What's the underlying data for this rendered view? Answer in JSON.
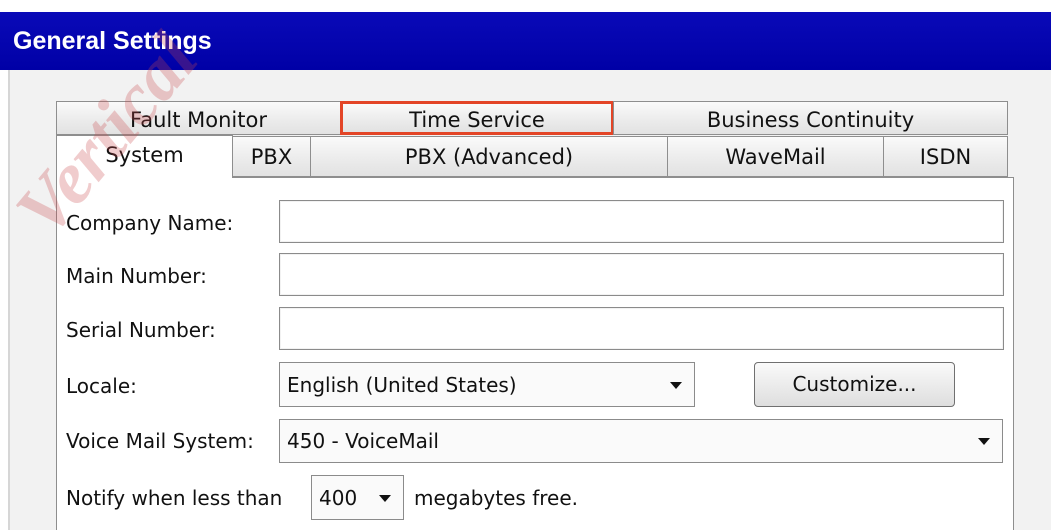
{
  "window": {
    "title": "General Settings",
    "watermark": "Vertical"
  },
  "tabs": {
    "row1": [
      "Fault Monitor",
      "Time Service",
      "Business Continuity"
    ],
    "row2": [
      "System",
      "PBX",
      "PBX (Advanced)",
      "WaveMail",
      "ISDN"
    ],
    "selected": "System",
    "highlighted": "Time Service"
  },
  "system": {
    "company_name_label": "Company Name:",
    "company_name_value": "",
    "main_number_label": "Main Number:",
    "main_number_value": "",
    "serial_number_label": "Serial Number:",
    "serial_number_value": "",
    "locale_label": "Locale:",
    "locale_value": "English (United States)",
    "customize_label": "Customize...",
    "voice_mail_label": "Voice Mail System:",
    "voice_mail_value": "450 - VoiceMail",
    "notify_prefix": "Notify when less than",
    "notify_value": "400",
    "notify_suffix": "megabytes free."
  },
  "colors": {
    "title_bar": "#0000a6",
    "highlight_border": "#e34527",
    "watermark": "#c8484a"
  }
}
